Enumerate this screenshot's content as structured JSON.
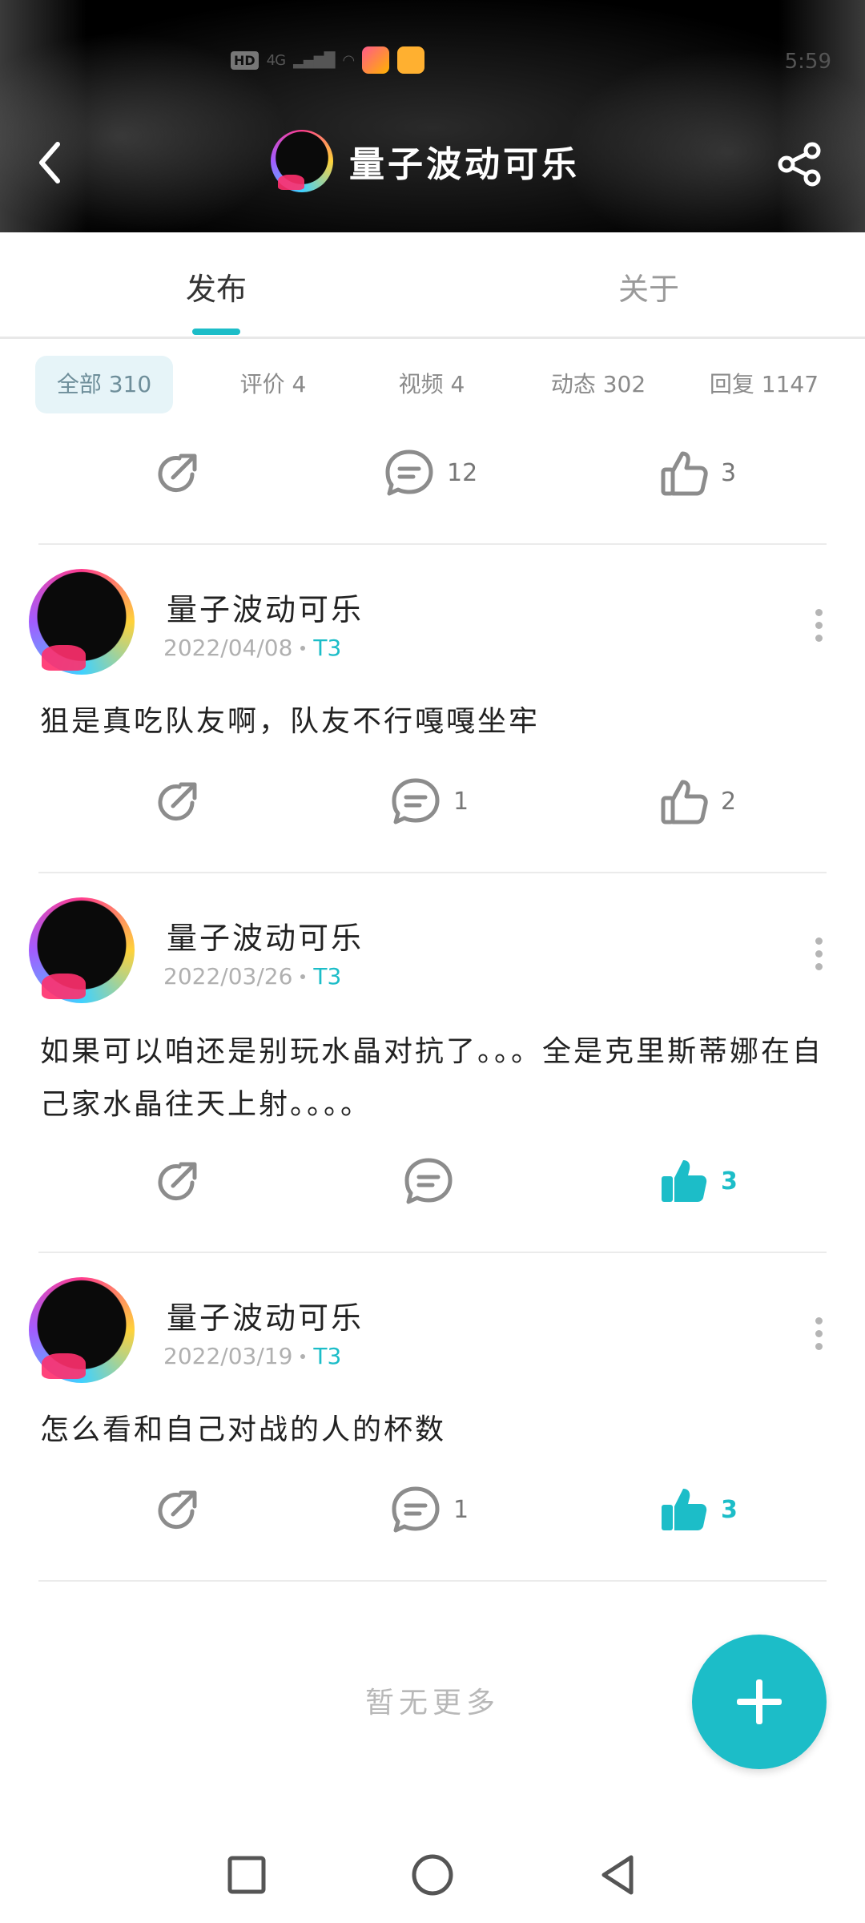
{
  "status_bar": {
    "hd_label": "HD",
    "net_label": "4G",
    "time": "5:59"
  },
  "header": {
    "title": "量子波动可乐",
    "back_icon": "chevron-left-icon",
    "share_icon": "share-icon"
  },
  "tabs": [
    {
      "label": "发布",
      "active": true
    },
    {
      "label": "关于",
      "active": false
    }
  ],
  "filters": [
    {
      "label": "全部 310",
      "active": true
    },
    {
      "label": "评价 4",
      "active": false
    },
    {
      "label": "视频 4",
      "active": false
    },
    {
      "label": "动态 302",
      "active": false
    },
    {
      "label": "回复 1147",
      "active": false
    }
  ],
  "top_actions": {
    "comments": "12",
    "likes": "3",
    "liked": false
  },
  "posts": [
    {
      "author": "量子波动可乐",
      "date": "2022/04/08",
      "level": "T3",
      "text": "狙是真吃队友啊，队友不行嘎嘎坐牢",
      "comments": "1",
      "likes": "2",
      "liked": false
    },
    {
      "author": "量子波动可乐",
      "date": "2022/03/26",
      "level": "T3",
      "text": "如果可以咱还是别玩水晶对抗了。。。全是克里斯蒂娜在自己家水晶往天上射。。。。",
      "comments": "",
      "likes": "3",
      "liked": true
    },
    {
      "author": "量子波动可乐",
      "date": "2022/03/19",
      "level": "T3",
      "text": "怎么看和自己对战的人的杯数",
      "comments": "1",
      "likes": "3",
      "liked": true
    }
  ],
  "footer": {
    "no_more": "暂无更多"
  },
  "colors": {
    "accent": "#1cbdc8",
    "icon_gray": "#8c8c8c"
  }
}
